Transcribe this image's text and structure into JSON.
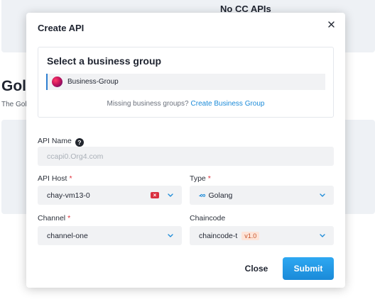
{
  "background": {
    "top_card_text": "No CC APIs",
    "heading": "Gol",
    "subtext": "The Gol"
  },
  "modal": {
    "title": "Create API",
    "business_group": {
      "title": "Select a business group",
      "selected": "Business-Group",
      "missing_text": "Missing business groups?",
      "missing_link": "Create Business Group"
    },
    "api_name": {
      "label": "API Name",
      "placeholder": "ccapi0.Org4.com"
    },
    "api_host": {
      "label": "API Host",
      "required": "*",
      "value": "chay-vm13-0"
    },
    "type": {
      "label": "Type",
      "required": "*",
      "value": "Golang",
      "icon": "golang-icon"
    },
    "channel": {
      "label": "Channel",
      "required": "*",
      "value": "channel-one"
    },
    "chaincode": {
      "label": "Chaincode",
      "value": "chaincode-t",
      "version": "v1.0"
    },
    "buttons": {
      "close": "Close",
      "submit": "Submit"
    }
  },
  "colors": {
    "accent": "#1a8ad8",
    "required": "#e0303a",
    "clear_icon": "#d93040",
    "version_badge_bg": "#fde4d8"
  }
}
